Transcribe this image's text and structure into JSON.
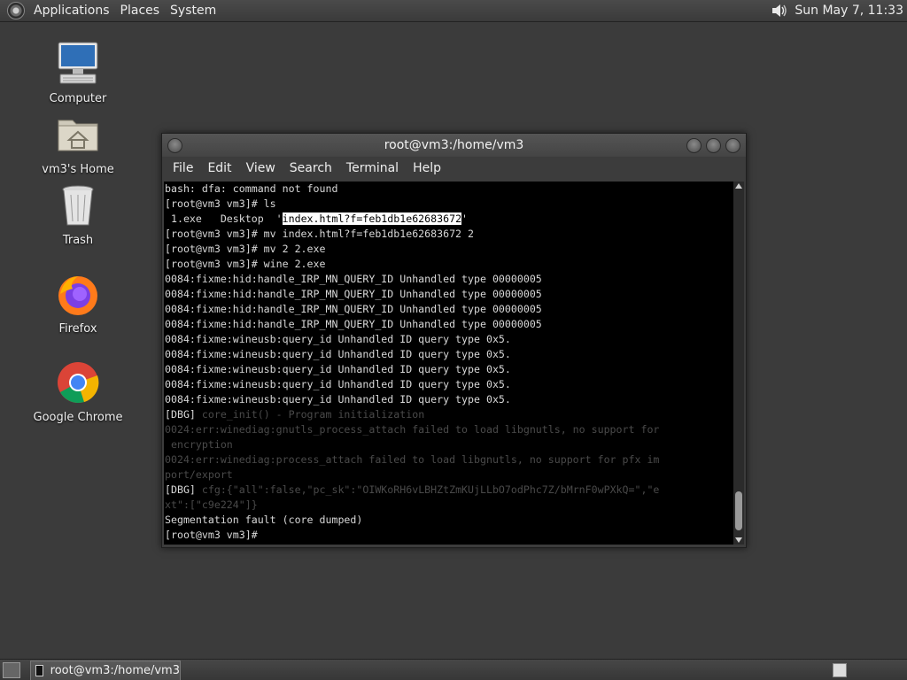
{
  "top_panel": {
    "menus": [
      "Applications",
      "Places",
      "System"
    ],
    "clock": "Sun May  7, 11:33"
  },
  "desktop_icons": [
    {
      "label": "Computer",
      "icon": "computer-icon"
    },
    {
      "label": "vm3's Home",
      "icon": "home-folder-icon"
    },
    {
      "label": "Trash",
      "icon": "trash-icon"
    },
    {
      "label": "Firefox",
      "icon": "firefox-icon"
    },
    {
      "label": "Google Chrome",
      "icon": "chrome-icon"
    }
  ],
  "terminal": {
    "title": "root@vm3:/home/vm3",
    "menu": [
      "File",
      "Edit",
      "View",
      "Search",
      "Terminal",
      "Help"
    ],
    "lines": [
      {
        "text": "bash: dfa: command not found",
        "dim": false
      },
      {
        "text": "[root@vm3 vm3]# ls",
        "dim": false
      },
      {
        "pre": " 1.exe   Desktop  '",
        "sel": "index.html?f=feb1db1e62683672",
        "post": "'"
      },
      {
        "text": "[root@vm3 vm3]# mv index.html?f=feb1db1e62683672 2",
        "dim": false
      },
      {
        "text": "[root@vm3 vm3]# mv 2 2.exe",
        "dim": false
      },
      {
        "text": "[root@vm3 vm3]# wine 2.exe",
        "dim": false
      },
      {
        "text": "0084:fixme:hid:handle_IRP_MN_QUERY_ID Unhandled type 00000005",
        "dim": false
      },
      {
        "text": "0084:fixme:hid:handle_IRP_MN_QUERY_ID Unhandled type 00000005",
        "dim": false
      },
      {
        "text": "0084:fixme:hid:handle_IRP_MN_QUERY_ID Unhandled type 00000005",
        "dim": false
      },
      {
        "text": "0084:fixme:hid:handle_IRP_MN_QUERY_ID Unhandled type 00000005",
        "dim": false
      },
      {
        "text": "0084:fixme:wineusb:query_id Unhandled ID query type 0x5.",
        "dim": false
      },
      {
        "text": "0084:fixme:wineusb:query_id Unhandled ID query type 0x5.",
        "dim": false
      },
      {
        "text": "0084:fixme:wineusb:query_id Unhandled ID query type 0x5.",
        "dim": false
      },
      {
        "text": "0084:fixme:wineusb:query_id Unhandled ID query type 0x5.",
        "dim": false
      },
      {
        "text": "0084:fixme:wineusb:query_id Unhandled ID query type 0x5.",
        "dim": false
      },
      {
        "pre": "[DBG] ",
        "dimtext": "core_init() - Program initialization"
      },
      {
        "text": "0024:err:winediag:gnutls_process_attach failed to load libgnutls, no support for",
        "dim": true
      },
      {
        "text": " encryption",
        "dim": true
      },
      {
        "text": "0024:err:winediag:process_attach failed to load libgnutls, no support for pfx im",
        "dim": true
      },
      {
        "text": "port/export",
        "dim": true
      },
      {
        "pre": "[DBG] ",
        "dimtext": "cfg:{\"all\":false,\"pc_sk\":\"OIWKoRH6vLBHZtZmKUjLLbO7odPhc7Z/bMrnF0wPXkQ=\",\"e"
      },
      {
        "text": "xt\":[\"c9e224\"]}",
        "dim": true
      },
      {
        "text": "Segmentation fault (core dumped)",
        "dim": false
      },
      {
        "text": "[root@vm3 vm3]# ",
        "dim": false
      }
    ]
  },
  "taskbar": {
    "task_label": "root@vm3:/home/vm3"
  },
  "colors": {
    "desktop_bg": "#3b3b3b",
    "terminal_bg": "#000000",
    "terminal_fg": "#d8d8d8",
    "selection_bg": "#ffffff"
  }
}
